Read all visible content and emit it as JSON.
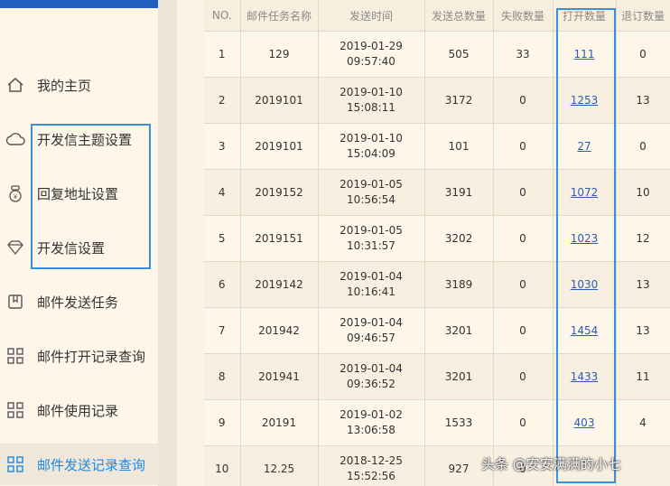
{
  "sidebar": {
    "items": [
      {
        "label": "我的主页",
        "icon": "home-icon"
      },
      {
        "label": "开发信主题设置",
        "icon": "cloud-icon"
      },
      {
        "label": "回复地址设置",
        "icon": "money-bag-icon"
      },
      {
        "label": "开发信设置",
        "icon": "diamond-icon"
      },
      {
        "label": "邮件发送任务",
        "icon": "bookmark-icon"
      },
      {
        "label": "邮件打开记录查询",
        "icon": "grid-icon"
      },
      {
        "label": "邮件使用记录",
        "icon": "grid-icon"
      },
      {
        "label": "邮件发送记录查询",
        "icon": "grid-icon"
      }
    ],
    "active_index": 7
  },
  "table": {
    "headers": [
      "NO.",
      "邮件任务名称",
      "发送时间",
      "发送总数量",
      "失败数量",
      "打开数量",
      "退订数量"
    ],
    "rows": [
      {
        "no": "1",
        "name": "129",
        "date": "2019-01-29",
        "time": "09:57:40",
        "total": "505",
        "failed": "33",
        "opened": "111",
        "unsub": "0"
      },
      {
        "no": "2",
        "name": "2019101",
        "date": "2019-01-10",
        "time": "15:08:11",
        "total": "3172",
        "failed": "0",
        "opened": "1253",
        "unsub": "13"
      },
      {
        "no": "3",
        "name": "2019101",
        "date": "2019-01-10",
        "time": "15:04:09",
        "total": "101",
        "failed": "0",
        "opened": "27",
        "unsub": "0"
      },
      {
        "no": "4",
        "name": "2019152",
        "date": "2019-01-05",
        "time": "10:56:54",
        "total": "3191",
        "failed": "0",
        "opened": "1072",
        "unsub": "10"
      },
      {
        "no": "5",
        "name": "2019151",
        "date": "2019-01-05",
        "time": "10:31:57",
        "total": "3202",
        "failed": "0",
        "opened": "1023",
        "unsub": "12"
      },
      {
        "no": "6",
        "name": "2019142",
        "date": "2019-01-04",
        "time": "10:16:41",
        "total": "3189",
        "failed": "0",
        "opened": "1030",
        "unsub": "13"
      },
      {
        "no": "7",
        "name": "201942",
        "date": "2019-01-04",
        "time": "09:46:57",
        "total": "3201",
        "failed": "0",
        "opened": "1454",
        "unsub": "13"
      },
      {
        "no": "8",
        "name": "201941",
        "date": "2019-01-04",
        "time": "09:36:52",
        "total": "3201",
        "failed": "0",
        "opened": "1433",
        "unsub": "11"
      },
      {
        "no": "9",
        "name": "20191",
        "date": "2019-01-02",
        "time": "13:06:58",
        "total": "1533",
        "failed": "0",
        "opened": "403",
        "unsub": "4"
      },
      {
        "no": "10",
        "name": "12.25",
        "date": "2018-12-25",
        "time": "15:52:56",
        "total": "927",
        "failed": "0",
        "opened": "",
        "unsub": ""
      }
    ]
  },
  "watermark": "头条 @安安满满的小七",
  "colors": {
    "accent": "#1e88e5",
    "highlight": "#3a8fdc",
    "link": "#2a5db8"
  }
}
